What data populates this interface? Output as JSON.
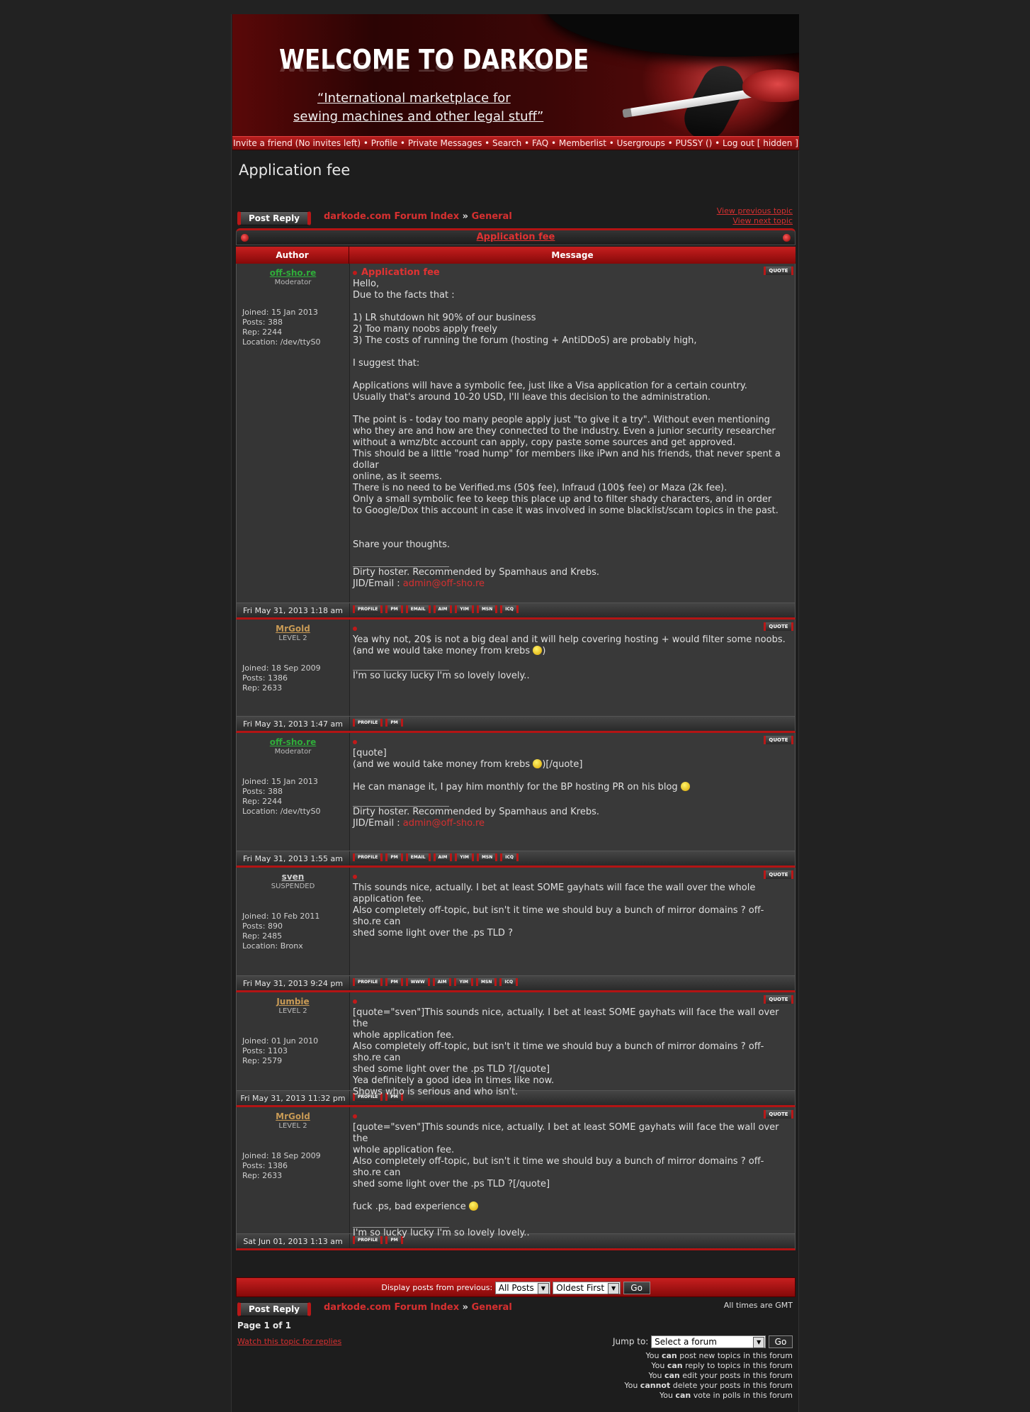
{
  "banner": {
    "title": "WELCOME TO DARKODE",
    "tagline1": "“International marketplace for",
    "tagline2": "sewing machines and other legal stuff”"
  },
  "nav": {
    "text": "Invite a friend (No invites left) • Profile • Private Messages • Search • FAQ • Memberlist • Usergroups • PUSSY () • Log out [ hidden ]"
  },
  "page": {
    "title": "Application fee",
    "post_reply": "Post Reply",
    "forum_index": "darkode.com Forum Index",
    "crumb_sep": "»",
    "forum_name": "General",
    "prev_topic": "View previous topic",
    "next_topic": "View next topic",
    "topic_header": "Application fee",
    "col_author": "Author",
    "col_message": "Message",
    "quote_label": "QUOTE"
  },
  "buttons": {
    "profile": "PROFILE",
    "pm": "PM",
    "email": "EMAIL",
    "aim": "AIM",
    "yim": "YIM",
    "msn": "MSN",
    "icq": "ICQ",
    "www": "WWW"
  },
  "posts": [
    {
      "author": "off-sho.re",
      "rank": "Moderator",
      "joined": "Joined: 15 Jan 2013",
      "posts": "Posts: 388",
      "rep": "Rep: 2244",
      "location": "Location: /dev/ttyS0",
      "subject": "Application fee",
      "body": "Hello,\nDue to the facts that :\n\n1) LR shutdown hit 90% of our business\n2) Too many noobs apply freely\n3) The costs of running the forum (hosting + AntiDDoS) are probably high,\n\nI suggest that:\n\nApplications will have a symbolic fee, just like a Visa application for a certain country.\nUsually that's around 10-20 USD, I'll leave this decision to the administration.\n\nThe point is - today too many people apply just \"to give it a try\". Without even mentioning\nwho they are and how are they connected to the industry. Even a junior security researcher\nwithout a wmz/btc account can apply, copy paste some sources and get approved.\nThis should be a little \"road hump\" for members like iPwn and his friends, that never spent a\ndollar\nonline, as it seems.\nThere is no need to be Verified.ms (50$ fee), Infraud (100$ fee) or Maza (2k fee).\nOnly a small symbolic fee to keep this place up and to filter shady characters, and in order\nto Google/Dox this account in case it was involved in some blacklist/scam topics in the past.\n\n\nShare your thoughts.",
      "sig": "Dirty hoster. Recommended by Spamhaus and Krebs.",
      "jid_label": "JID/Email : ",
      "jid": "admin@off-sho.re",
      "date": "Fri May 31, 2013 1:18 am"
    },
    {
      "author": "MrGold",
      "rank": "LEVEL 2",
      "joined": "Joined: 18 Sep 2009",
      "posts": "Posts: 1386",
      "rep": "Rep: 2633",
      "body_a": "Yea why not, 20$ is not a big deal and it will help covering hosting + would filter some noobs.\n(and we would take money from krebs ",
      "body_b": ")",
      "sig": "I'm so lucky lucky I'm so lovely lovely..",
      "date": "Fri May 31, 2013 1:47 am"
    },
    {
      "author": "off-sho.re",
      "rank": "Moderator",
      "joined": "Joined: 15 Jan 2013",
      "posts": "Posts: 388",
      "rep": "Rep: 2244",
      "location": "Location: /dev/ttyS0",
      "body_a": "[quote]\n(and we would take money from krebs ",
      "body_b": ")[/quote]\n\nHe can manage it, I pay him monthly for the BP hosting PR on his blog ",
      "sig": "Dirty hoster. Recommended by Spamhaus and Krebs.",
      "jid_label": "JID/Email : ",
      "jid": "admin@off-sho.re",
      "date": "Fri May 31, 2013 1:55 am"
    },
    {
      "author": "sven",
      "rank": "SUSPENDED",
      "joined": "Joined: 10 Feb 2011",
      "posts": "Posts: 890",
      "rep": "Rep: 2485",
      "location": "Location: Bronx",
      "body": "This sounds nice, actually. I bet at least SOME gayhats will face the wall over the whole\napplication fee.\nAlso completely off-topic, but isn't it time we should buy a bunch of mirror domains ? off-sho.re can\nshed some light over the .ps TLD ?",
      "date": "Fri May 31, 2013 9:24 pm"
    },
    {
      "author": "Jumbie",
      "rank": "LEVEL 2",
      "joined": "Joined: 01 Jun 2010",
      "posts": "Posts: 1103",
      "rep": "Rep: 2579",
      "body": "[quote=\"sven\"]This sounds nice, actually. I bet at least SOME gayhats will face the wall over the\nwhole application fee.\nAlso completely off-topic, but isn't it time we should buy a bunch of mirror domains ? off-sho.re can\nshed some light over the .ps TLD ?[/quote]\nYea definitely a good idea in times like now.\nShows who is serious and who isn't.",
      "date": "Fri May 31, 2013 11:32 pm"
    },
    {
      "author": "MrGold",
      "rank": "LEVEL 2",
      "joined": "Joined: 18 Sep 2009",
      "posts": "Posts: 1386",
      "rep": "Rep: 2633",
      "body_a": "[quote=\"sven\"]This sounds nice, actually. I bet at least SOME gayhats will face the wall over the\nwhole application fee.\nAlso completely off-topic, but isn't it time we should buy a bunch of mirror domains ? off-sho.re can\nshed some light over the .ps TLD ?[/quote]\n\nfuck .ps, bad experience ",
      "sig": "I'm so lucky lucky I'm so lovely lovely..",
      "date": "Sat Jun 01, 2013 1:13 am"
    }
  ],
  "bottom": {
    "display_label": "Display posts from previous:",
    "all_posts": "All Posts",
    "oldest_first": "Oldest First",
    "go": "Go",
    "timezone": "All times are GMT",
    "pages": "Page 1 of 1",
    "watch": "Watch this topic for replies",
    "jump_label": "Jump to:",
    "jump_select": "Select a forum",
    "perm1a": "You ",
    "perm1b": "can",
    "perm1c": " post new topics in this forum",
    "perm2a": "You ",
    "perm2b": "can",
    "perm2c": " reply to topics in this forum",
    "perm3a": "You ",
    "perm3b": "can",
    "perm3c": " edit your posts in this forum",
    "perm4a": "You ",
    "perm4b": "cannot",
    "perm4c": " delete your posts in this forum",
    "perm5a": "You ",
    "perm5b": "can",
    "perm5c": " vote in polls in this forum"
  },
  "colors": {
    "accent": "#d63030",
    "moderator": "#2fae3a",
    "level2": "#c89a55",
    "suspended": "#d0d0d0"
  }
}
